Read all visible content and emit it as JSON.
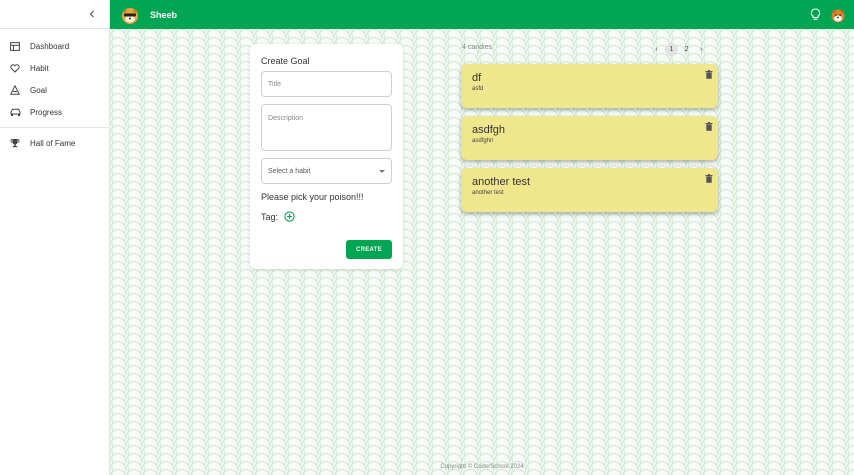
{
  "app": {
    "title": "Sheeb"
  },
  "sidebar": {
    "items": [
      {
        "label": "Dashboard",
        "icon": "dashboard-icon"
      },
      {
        "label": "Habit",
        "icon": "heart-icon"
      },
      {
        "label": "Goal",
        "icon": "goal-icon"
      },
      {
        "label": "Progress",
        "icon": "car-icon"
      }
    ],
    "bottom_items": [
      {
        "label": "Hall of Fame",
        "icon": "trophy-icon"
      }
    ]
  },
  "goal_form": {
    "heading": "Create Goal",
    "title_placeholder": "Title",
    "description_placeholder": "Description",
    "select_value": "Select a habit",
    "poison_text": "Please pick your poison!!!",
    "tag_label": "Tag:",
    "create_label": "CREATE"
  },
  "candies": {
    "count_text": "4 candies",
    "pagination": {
      "prev": "‹",
      "pages": [
        "1",
        "2"
      ],
      "next": "›",
      "active": "1"
    },
    "items": [
      {
        "name": "df",
        "description": "asfd"
      },
      {
        "name": "asdfgh",
        "description": "asdfghn"
      },
      {
        "name": "another test",
        "description": "another test"
      }
    ]
  },
  "footer": {
    "text": "Copyright © CoderSchool 2024"
  },
  "colors": {
    "primary": "#00a651",
    "candy": "#f0e68c"
  }
}
